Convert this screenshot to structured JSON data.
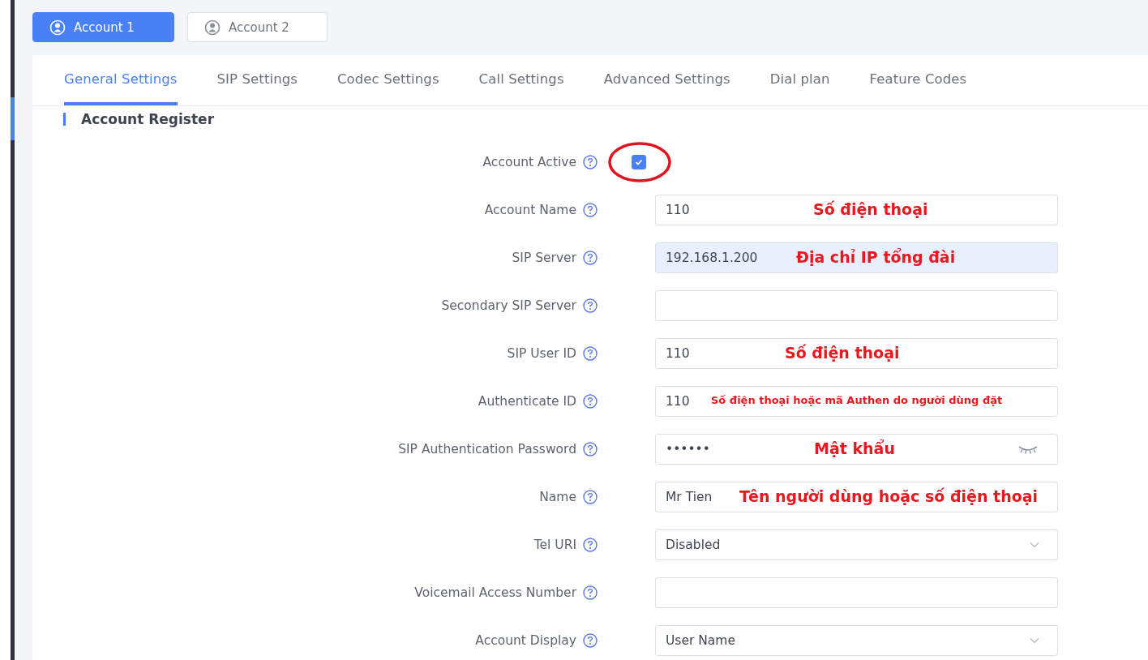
{
  "account_tabs": [
    {
      "label": "Account 1",
      "selected": true
    },
    {
      "label": "Account 2",
      "selected": false
    }
  ],
  "settings_tabs": [
    {
      "label": "General Settings",
      "selected": true
    },
    {
      "label": "SIP Settings",
      "selected": false
    },
    {
      "label": "Codec Settings",
      "selected": false
    },
    {
      "label": "Call Settings",
      "selected": false
    },
    {
      "label": "Advanced Settings",
      "selected": false
    },
    {
      "label": "Dial plan",
      "selected": false
    },
    {
      "label": "Feature Codes",
      "selected": false
    }
  ],
  "section": {
    "title": "Account Register"
  },
  "fields": [
    {
      "kind": "checkbox",
      "label": "Account Active",
      "checked": true,
      "circled": true
    },
    {
      "kind": "text",
      "label": "Account Name",
      "value": "110",
      "note": "Số điện thoại"
    },
    {
      "kind": "text",
      "label": "SIP Server",
      "value": "192.168.1.200",
      "autofilled": true,
      "note": "Địa chỉ IP tổng đài"
    },
    {
      "kind": "text",
      "label": "Secondary SIP Server"
    },
    {
      "kind": "text",
      "label": "SIP User ID",
      "value": "110",
      "note": "Số điện thoại"
    },
    {
      "kind": "text",
      "label": "Authenticate ID",
      "value": "110",
      "note": "Số điện thoại hoặc mã Authen do người dùng đặt"
    },
    {
      "kind": "password",
      "label": "SIP Authentication Password",
      "value": "••••••",
      "note": "Mật khẩu"
    },
    {
      "kind": "text",
      "label": "Name",
      "value": "Mr Tien",
      "note": "Tên người dùng hoặc số điện thoại"
    },
    {
      "kind": "select",
      "label": "Tel URI",
      "value": "Disabled"
    },
    {
      "kind": "text",
      "label": "Voicemail Access Number"
    },
    {
      "kind": "select",
      "label": "Account Display",
      "value": "User Name"
    }
  ]
}
